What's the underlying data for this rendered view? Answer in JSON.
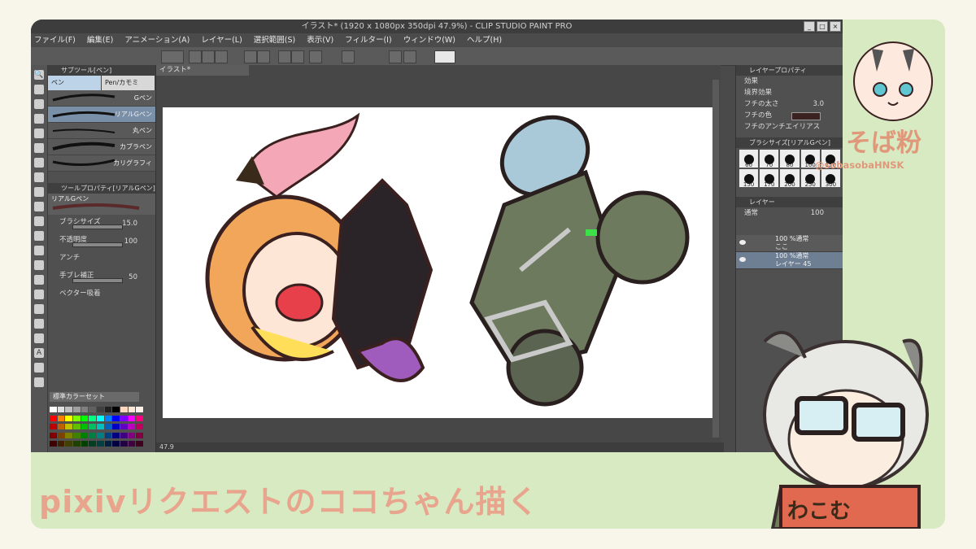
{
  "app": {
    "title": "イラスト* (1920 x 1080px 350dpi 47.9%) - CLIP STUDIO PAINT PRO",
    "menus": [
      "ファイル(F)",
      "編集(E)",
      "アニメーション(A)",
      "レイヤー(L)",
      "選択範囲(S)",
      "表示(V)",
      "フィルター(I)",
      "ウィンドウ(W)",
      "ヘルプ(H)"
    ],
    "canvas_tab": "イラスト*",
    "zoom": "47.9"
  },
  "subtool": {
    "panel_title": "サブツール[ペン]",
    "tabs": [
      "ペン",
      "Pen/カモミ"
    ],
    "brushes": [
      "Gペン",
      "リアルGペン",
      "丸ペン",
      "カブラペン",
      "カリグラフィ"
    ],
    "selected_index": 1
  },
  "toolprop": {
    "panel_title": "ツールプロパティ[リアルGペン]",
    "brush_name": "リアルGペン",
    "brush_size_label": "ブラシサイズ",
    "brush_size": "15.0",
    "opacity_label": "不透明度",
    "opacity": "100",
    "antialias_label": "アンチ",
    "stabilize_label": "手ブレ補正",
    "stabilize": "50",
    "vector_label": "ベクター吸着"
  },
  "color_set": {
    "selected": "標準カラーセット",
    "colors": [
      "#ffffff",
      "#e0e0e0",
      "#c0c0c0",
      "#a0a0a0",
      "#808080",
      "#606060",
      "#404040",
      "#202020",
      "#000000",
      "#ffd8c0",
      "#ffe8d8",
      "#fff0e8",
      "#ff0000",
      "#ff8000",
      "#ffff00",
      "#80ff00",
      "#00ff00",
      "#00ff80",
      "#00ffff",
      "#0080ff",
      "#0000ff",
      "#8000ff",
      "#ff00ff",
      "#ff0080",
      "#c00000",
      "#c06000",
      "#c0c000",
      "#60c000",
      "#00c000",
      "#00c060",
      "#00c0c0",
      "#0060c0",
      "#0000c0",
      "#6000c0",
      "#c000c0",
      "#c00060",
      "#800000",
      "#804000",
      "#808000",
      "#408000",
      "#008000",
      "#008040",
      "#008080",
      "#004080",
      "#000080",
      "#400080",
      "#800080",
      "#800040",
      "#400000",
      "#402000",
      "#404000",
      "#204000",
      "#004000",
      "#004020",
      "#004040",
      "#002040",
      "#000040",
      "#200040",
      "#400040",
      "#400020"
    ]
  },
  "layer_prop": {
    "panel_title": "レイヤープロパティ",
    "effect_label": "効果",
    "border_label": "境界効果",
    "border_width_label": "フチの太さ",
    "border_width": "3.0",
    "border_color_label": "フチの色",
    "border_aa_label": "フチのアンチエイリアス"
  },
  "brush_size_panel": {
    "panel_title": "ブラシサイズ[リアルGペン]",
    "sizes": [
      "60",
      "70",
      "80",
      "100",
      "120",
      "150",
      "170",
      "200",
      "250",
      "300"
    ]
  },
  "layers": {
    "panel_title": "レイヤー",
    "blend": "通常",
    "opacity": "100",
    "items": [
      {
        "name": "100 %通常",
        "sub": "ここ"
      },
      {
        "name": "100 %通常",
        "sub": "レイヤー 45"
      }
    ]
  },
  "overlay": {
    "banner": "pixivリクエストのココちゃん描く",
    "artist_name": "そば粉",
    "artist_handle": "@sobasobaHNSK",
    "signboard": "わこむ"
  },
  "colors": {
    "frame_bg": "#d7eac2",
    "banner_text": "#e8a48c",
    "name_text": "#e0987a"
  }
}
